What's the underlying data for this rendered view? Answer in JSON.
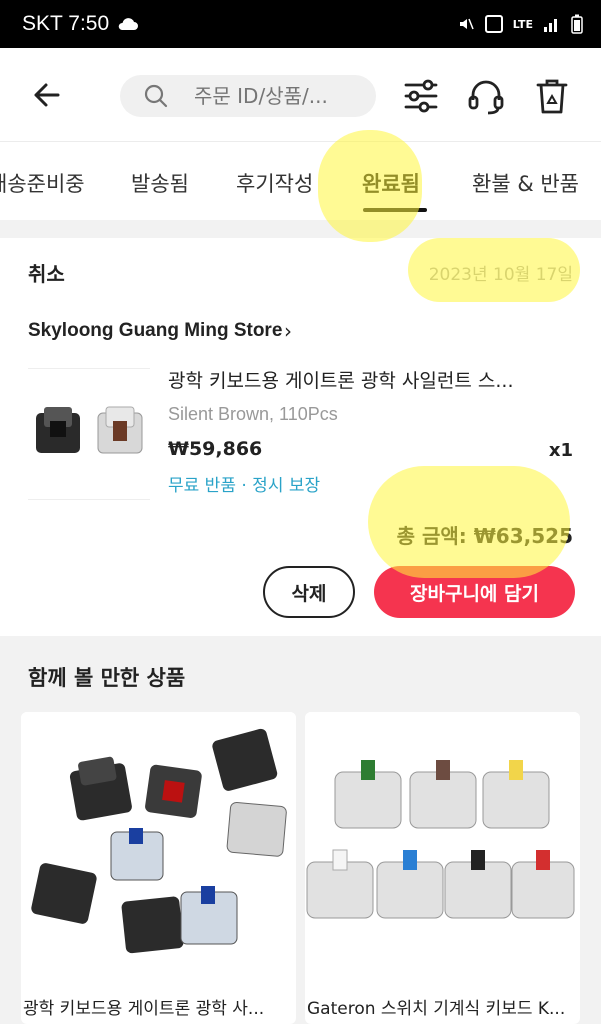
{
  "status_bar": {
    "carrier_time": "SKT 7:50",
    "indicators": [
      "mute-icon",
      "hd-voice-icon",
      "lte-icon",
      "signal-icon",
      "battery-icon"
    ]
  },
  "header": {
    "search_placeholder": "주문 ID/상품/..."
  },
  "tabs": [
    {
      "label": "배송준비중",
      "active": false
    },
    {
      "label": "발송됨",
      "active": false
    },
    {
      "label": "후기작성",
      "active": false
    },
    {
      "label": "완료됨",
      "active": true
    },
    {
      "label": "환불 & 반품",
      "active": false
    }
  ],
  "order": {
    "status": "취소",
    "date": "2023년 10월 17일",
    "store": "Skyloong Guang Ming Store",
    "product": {
      "title": "광학 키보드용 게이트론 광학 사일런트 스...",
      "variant": "Silent Brown, 110Pcs",
      "price": "₩59,866",
      "qty": "x1",
      "tags": "무료 반품 · 정시 보장"
    },
    "total": "총 금액: ₩63,525",
    "delete_label": "삭제",
    "cart_label": "장바구니에 담기"
  },
  "recommendations": {
    "title": "함께 볼 만한 상품",
    "items": [
      {
        "name": "광학 키보드용 게이트론 광학 사..."
      },
      {
        "name": "Gateron 스위치 기계식 키보드 K..."
      }
    ]
  },
  "colors": {
    "accent": "#f5344f",
    "link": "#2aa3c8",
    "highlight": "#fff53c"
  }
}
